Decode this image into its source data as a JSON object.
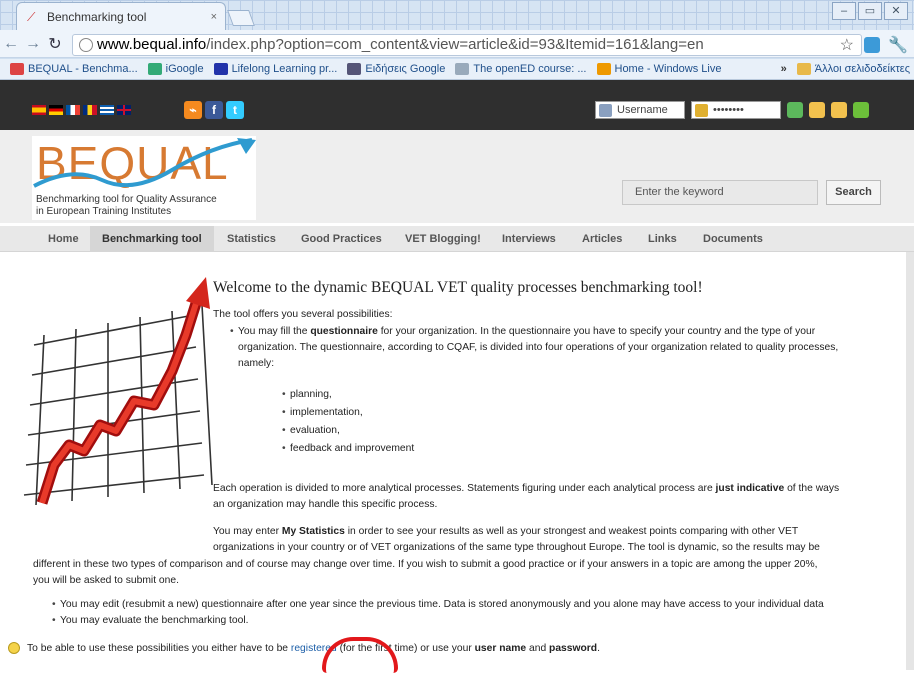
{
  "browser": {
    "tab_title": "Benchmarking tool",
    "tab_close": "×",
    "url_domain": "www.bequal.info",
    "url_path": "/index.php?option=com_content&view=article&id=93&Itemid=161&lang=en",
    "bookmarks": [
      "BEQUAL - Benchma...",
      "iGoogle",
      "Lifelong Learning pr...",
      "Ειδήσεις Google",
      "The openED course: ...",
      "Home - Windows Live"
    ],
    "bookmark_overflow": "»",
    "other_bookmarks": "Άλλοι σελιδοδείκτες"
  },
  "topbar": {
    "username_placeholder": "Username",
    "password_value": "••••••••"
  },
  "header": {
    "logo_text": "BEQUAL",
    "logo_subtitle_line1": "Benchmarking tool for Quality Assurance",
    "logo_subtitle_line2": "in European Training Institutes",
    "search_placeholder": "Enter the keyword",
    "search_button": "Search"
  },
  "menu": {
    "items": [
      "Home",
      "Benchmarking tool",
      "Statistics",
      "Good Practices",
      "VET Blogging!",
      "Interviews",
      "Articles",
      "Links",
      "Documents"
    ],
    "active": "Benchmarking tool"
  },
  "article": {
    "title": "Welcome to the dynamic BEQUAL VET quality processes benchmarking tool!",
    "intro": "The tool offers you several possibilities:",
    "q_pre": "You may fill the ",
    "q_bold": "questionnaire",
    "q_post1": " for your organization. In the questionnaire you have to specify your country and the type of your",
    "q_post2": "organization. The questionnaire, according to CQAF, is divided into four operations of your organization related to quality processes,",
    "q_post3": "namely:",
    "ops": [
      "planning,",
      "implementation,",
      "evaluation,",
      "feedback and improvement"
    ],
    "each_pre": "Each operation is divided to more analytical processes. Statements figuring under each analytical process are ",
    "each_bold": "just indicative",
    "each_post": " of the ways",
    "each_line2": "an organization may handle this specific process.",
    "stats_pre": "You may enter ",
    "stats_bold": "My Statistics",
    "stats_post": " in order to see your results as well as your strongest and weakest points comparing with other VET",
    "stats_line2": "organizations in your country or of VET organizations of the same type throughout Europe. The tool is dynamic, so the results may be",
    "stats_line3": "different in these two types of comparison and of course may change over time. If you wish to submit a good practice or if your answers in a topic are among the upper 20%,",
    "stats_line4": "you will be asked to submit one.",
    "bullet_edit": "You may edit (resubmit a new) questionnaire after one year since the previous time. Data is stored anonymously and you alone may have access to your individual data",
    "bullet_eval": "You may evaluate the benchmarking tool.",
    "final_pre": "To be able to use these possibilities you either have to ",
    "final_be": "be ",
    "final_link": "registered",
    "final_mid": " (for the first time) or use your ",
    "final_user": "user name",
    "final_and": " and ",
    "final_pass": "password",
    "final_end": "."
  }
}
